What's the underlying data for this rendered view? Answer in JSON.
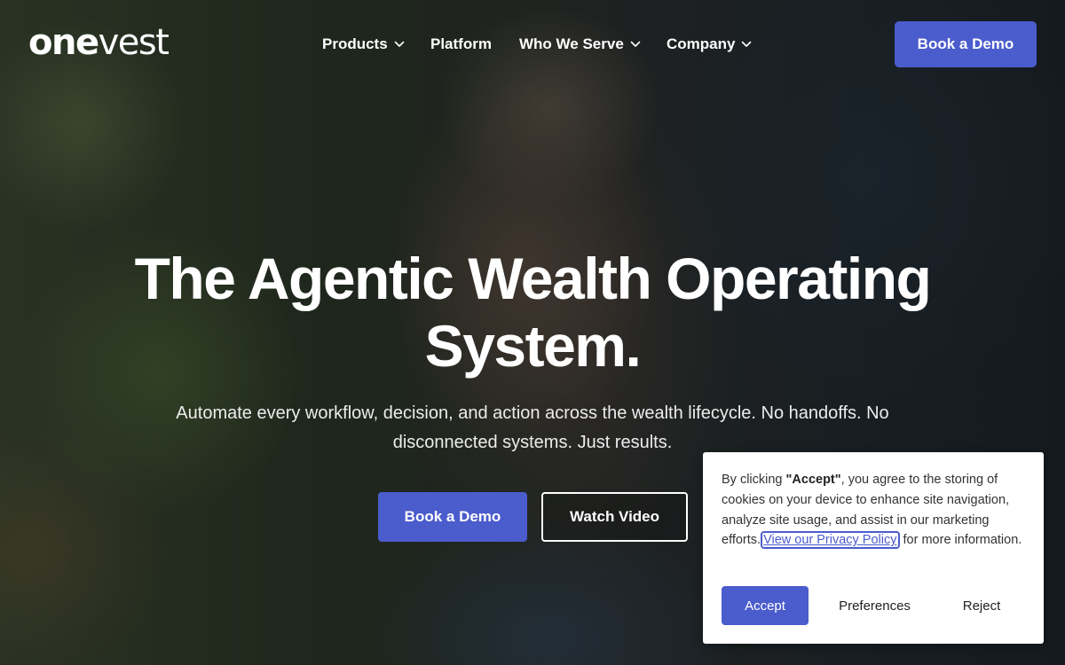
{
  "brand": {
    "logo_bold": "one",
    "logo_light": "vest",
    "accent_color": "#4b5ccd"
  },
  "nav": {
    "items": [
      {
        "label": "Products",
        "has_dropdown": true
      },
      {
        "label": "Platform",
        "has_dropdown": false
      },
      {
        "label": "Who We Serve",
        "has_dropdown": true
      },
      {
        "label": "Company",
        "has_dropdown": true
      }
    ],
    "cta_label": "Book a Demo",
    "dropdown_icon": "chevron-down-icon"
  },
  "hero": {
    "headline": "The Agentic Wealth Operating System.",
    "subheadline": "Automate every workflow, decision, and action across the wealth lifecycle. No handoffs. No disconnected systems. Just results.",
    "primary_cta": "Book a Demo",
    "secondary_cta": "Watch Video"
  },
  "cookie_banner": {
    "text_before": "By clicking ",
    "accept_quote": "\"Accept\"",
    "text_middle": ", you agree to the storing of cookies on your device to enhance site navigation, analyze site usage, and assist in our marketing efforts.",
    "privacy_link": "View our Privacy Policy",
    "text_after": " for more information.",
    "accept_label": "Accept",
    "preferences_label": "Preferences",
    "reject_label": "Reject"
  }
}
